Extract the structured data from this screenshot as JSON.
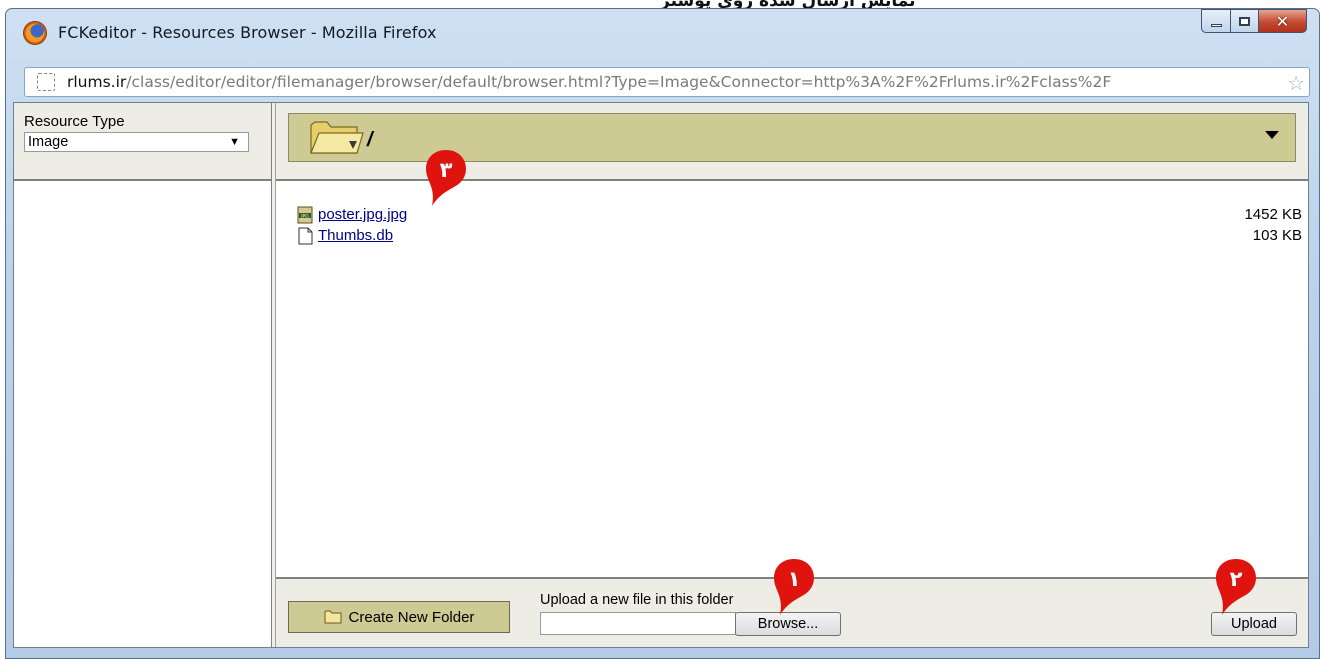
{
  "page_heading": "نمایش ارسال شده روی پوستر",
  "window": {
    "title": "FCKeditor - Resources Browser - Mozilla Firefox"
  },
  "address_bar": {
    "domain": "rlums.ir",
    "path": "/class/editor/editor/filemanager/browser/default/browser.html?Type=Image&Connector=http%3A%2F%2Frlums.ir%2Fclass%2F"
  },
  "resource_type": {
    "label": "Resource Type",
    "selected": "Image"
  },
  "folder_bar": {
    "path": "/"
  },
  "files": [
    {
      "name": "poster.jpg.jpg",
      "size": "1452 KB",
      "icon": "jpg-file-icon"
    },
    {
      "name": "Thumbs.db",
      "size": "103 KB",
      "icon": "generic-file-icon"
    }
  ],
  "bottom_bar": {
    "create_folder_label": "Create New Folder",
    "upload_label": "Upload a new file in this folder",
    "browse_label": "Browse...",
    "upload_button_label": "Upload"
  },
  "markers": [
    {
      "number": "١",
      "target": "browse-button"
    },
    {
      "number": "٢",
      "target": "upload-button"
    },
    {
      "number": "٣",
      "target": "poster-file-link"
    }
  ],
  "colors": {
    "panel_bg": "#eeede5",
    "folder_bar_bg": "#cdca93",
    "link": "#00008b",
    "marker_red": "#e0140f"
  }
}
